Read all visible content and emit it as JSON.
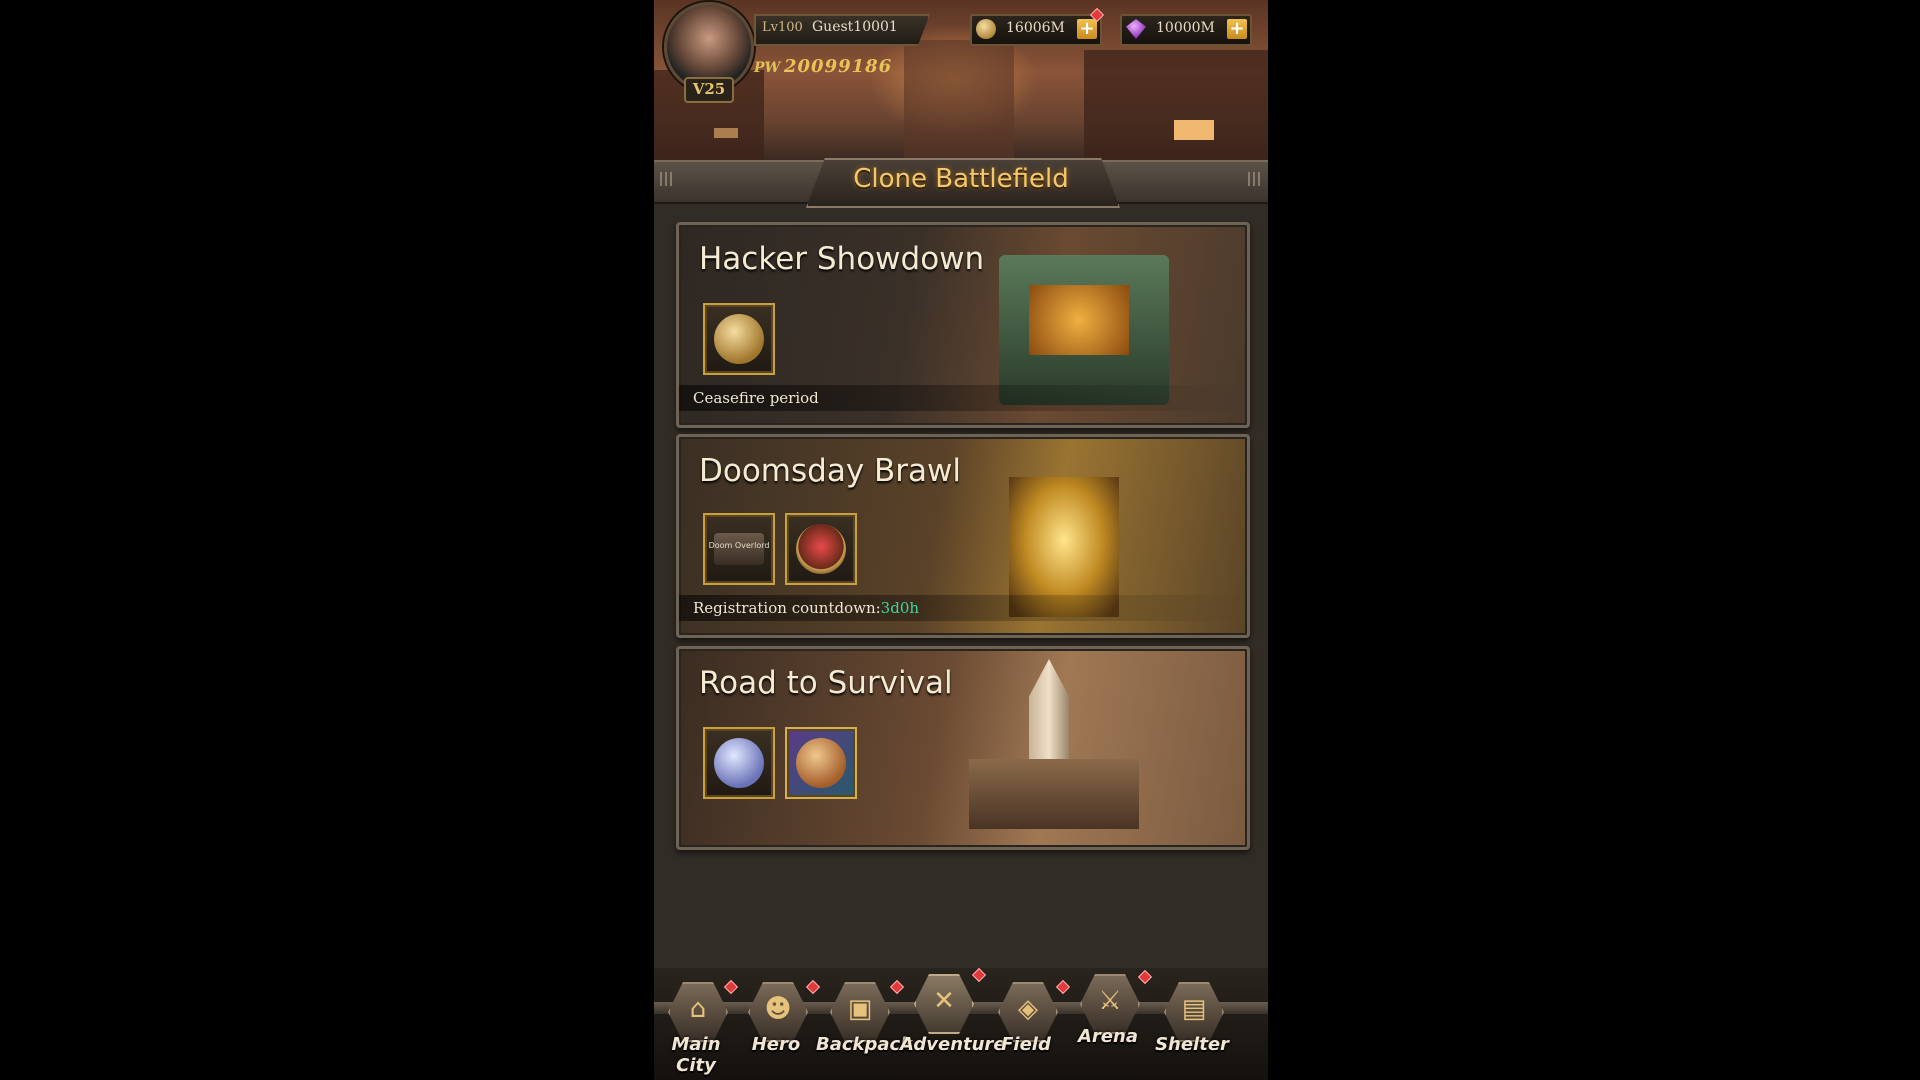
{
  "player": {
    "level": "Lv100",
    "name": "Guest10001",
    "vip": "V25",
    "power_label": "PW",
    "power": "20099186"
  },
  "resources": {
    "coins": "16006M",
    "gems": "10000M",
    "add_symbol": "+"
  },
  "screen_title": "Clone Battlefield",
  "events": [
    {
      "title": "Hacker Showdown",
      "status": "Ceasefire period"
    },
    {
      "title": "Doomsday Brawl",
      "status_prefix": "Registration countdown:",
      "countdown": "3d0h",
      "item_text": "Doom Overlord"
    },
    {
      "title": "Road to Survival"
    }
  ],
  "nav": {
    "items": [
      {
        "label": "Main City",
        "icon": "house-icon"
      },
      {
        "label": "Hero",
        "icon": "hero-icon"
      },
      {
        "label": "Backpack",
        "icon": "backpack-icon"
      },
      {
        "label": "Adventure",
        "icon": "crossed-guns-icon"
      },
      {
        "label": "Field",
        "icon": "map-pin-icon"
      },
      {
        "label": "Arena",
        "icon": "swords-icon"
      },
      {
        "label": "Shelter",
        "icon": "bunker-icon"
      }
    ],
    "active": "Adventure"
  },
  "colors": {
    "accent_gold": "#f2c86a",
    "countdown_green": "#3fd6a0",
    "notification_red": "#e23a3a"
  }
}
